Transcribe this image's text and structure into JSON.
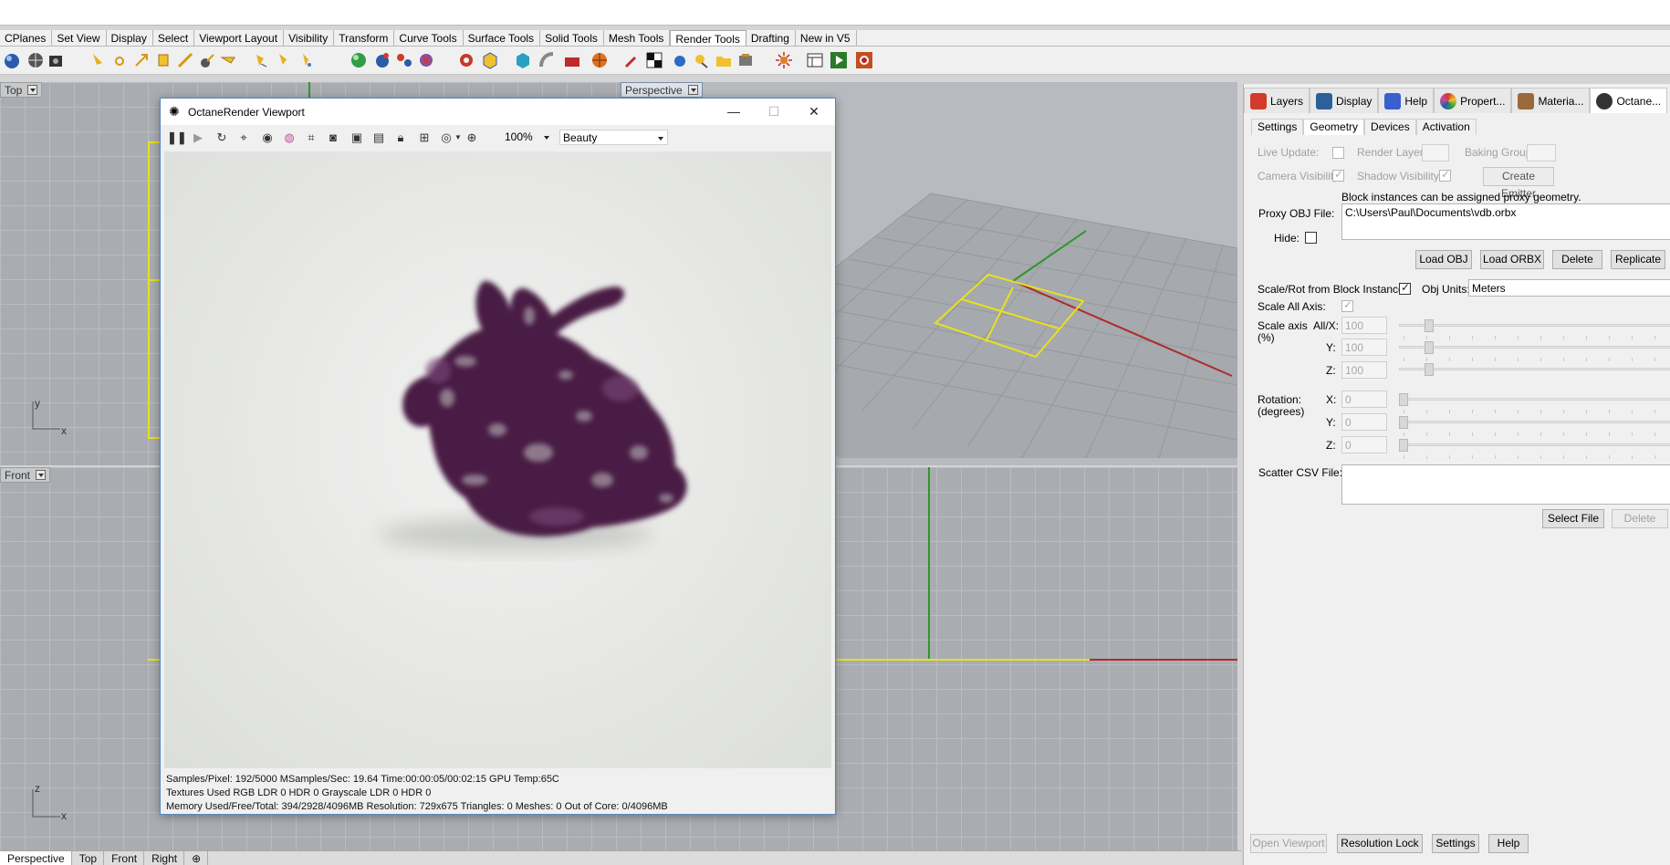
{
  "ribbon_tabs": [
    "CPlanes",
    "Set View",
    "Display",
    "Select",
    "Viewport Layout",
    "Visibility",
    "Transform",
    "Curve Tools",
    "Surface Tools",
    "Solid Tools",
    "Mesh Tools",
    "Render Tools",
    "Drafting",
    "New in V5"
  ],
  "active_ribbon_tab": "Render Tools",
  "viewports": {
    "top": "Top",
    "perspective": "Perspective",
    "front": "Front",
    "axis_y": "y",
    "axis_x": "x",
    "axis_z": "z"
  },
  "viewport_tabs": [
    "Perspective",
    "Top",
    "Front",
    "Right"
  ],
  "viewport_tab_add": "⊕",
  "octane_window": {
    "title": "OctaneRender Viewport",
    "zoom": "100%",
    "render_pass": "Beauty",
    "status_line1": "Samples/Pixel: 192/5000  MSamples/Sec: 19.64  Time:00:00:05/00:02:15  GPU Temp:65C",
    "status_line2": "Textures Used RGB LDR 0   HDR 0   Grayscale LDR 0   HDR 0",
    "status_line3": "Memory Used/Free/Total: 394/2928/4096MB  Resolution: 729x675  Triangles: 0  Meshes: 0 Out of Core: 0/4096MB"
  },
  "panel": {
    "tabs": [
      {
        "label": "Layers",
        "color": "#d43a2a"
      },
      {
        "label": "Display",
        "color": "#2d5f9a"
      },
      {
        "label": "Help",
        "color": "#3a5fcf"
      },
      {
        "label": "Propert...",
        "color": "#c04fa0"
      },
      {
        "label": "Materia...",
        "color": "#9a6a3a"
      },
      {
        "label": "Octane...",
        "color": "#333333"
      }
    ],
    "subtabs": [
      "Settings",
      "Geometry",
      "Devices",
      "Activation"
    ],
    "active_subtab": "Geometry",
    "live_update_label": "Live Update:",
    "render_layer_label": "Render Layer:",
    "baking_group_label": "Baking Group:",
    "camera_visibility_label": "Camera Visibility:",
    "shadow_visibility_label": "Shadow Visibility:",
    "create_emitter_label": "Create Emitter",
    "proxy_hint": "Block instances can be assigned proxy geometry.",
    "proxy_obj_label": "Proxy OBJ File:",
    "proxy_obj_value": "C:\\Users\\Paul\\Documents\\vdb.orbx",
    "hide_label": "Hide:",
    "load_obj": "Load OBJ",
    "load_orbx": "Load ORBX",
    "delete": "Delete",
    "replicate": "Replicate",
    "scale_rot_label": "Scale/Rot from Block Instance:",
    "obj_units_label": "Obj Units:",
    "obj_units_value": "Meters",
    "scale_all_axis_label": "Scale All Axis:",
    "scale_axis_label": "Scale axis",
    "scale_axis_unit": "(%)",
    "all_x_label": "All/X:",
    "y_label": "Y:",
    "z_label": "Z:",
    "x_label": "X:",
    "scale_x": "100",
    "scale_y": "100",
    "scale_z": "100",
    "rotation_label": "Rotation:",
    "rotation_unit": "(degrees)",
    "rot_x": "0",
    "rot_y": "0",
    "rot_z": "0",
    "scatter_csv_label": "Scatter CSV File:",
    "select_file": "Select File",
    "delete2": "Delete",
    "open_viewport": "Open Viewport",
    "resolution_lock": "Resolution Lock",
    "settings": "Settings",
    "help": "Help"
  }
}
